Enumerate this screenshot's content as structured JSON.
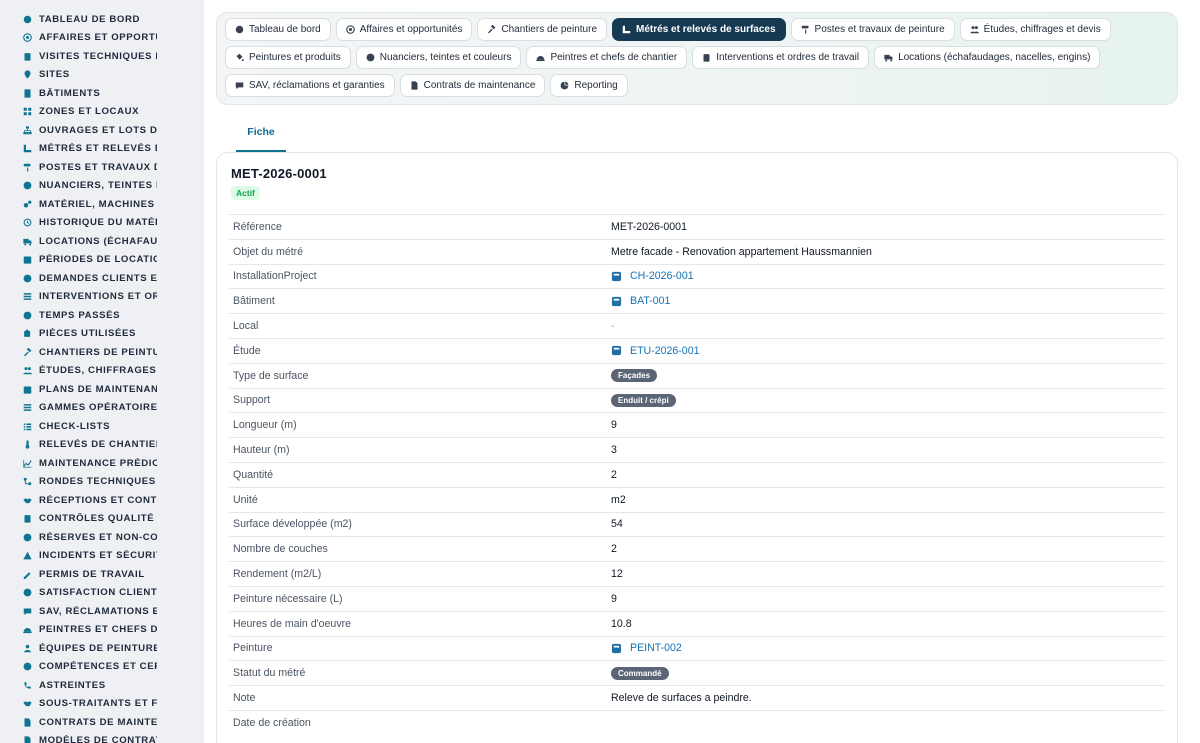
{
  "sidebar": {
    "items": [
      {
        "label": "TABLEAU DE BORD",
        "icon": "dashboard-icon"
      },
      {
        "label": "AFFAIRES ET OPPORTUNITÉS",
        "icon": "target-icon"
      },
      {
        "label": "VISITES TECHNIQUES ET",
        "icon": "clipboard-icon"
      },
      {
        "label": "SITES",
        "icon": "pin-icon"
      },
      {
        "label": "BÂTIMENTS",
        "icon": "building-icon"
      },
      {
        "label": "ZONES ET LOCAUX",
        "icon": "grid-icon"
      },
      {
        "label": "OUVRAGES ET LOTS DE TRAVAUX",
        "icon": "sitemap-icon"
      },
      {
        "label": "MÉTRÉS ET RELEVÉS DE SURFACES",
        "icon": "ruler-icon"
      },
      {
        "label": "POSTES ET TRAVAUX DE PEINTURE",
        "icon": "roller-icon"
      },
      {
        "label": "NUANCIERS, TEINTES ET COULEURS",
        "icon": "palette-icon"
      },
      {
        "label": "MATÉRIEL, MACHINES ET OUTILS",
        "icon": "cogs-icon"
      },
      {
        "label": "HISTORIQUE DU MATÉRIEL",
        "icon": "history-icon"
      },
      {
        "label": "LOCATIONS (ÉCHAFAUDAGES)",
        "icon": "truck-icon"
      },
      {
        "label": "PÉRIODES DE LOCATION",
        "icon": "calendar-icon"
      },
      {
        "label": "DEMANDES CLIENTS ET INTERVENTIONS",
        "icon": "question-icon"
      },
      {
        "label": "INTERVENTIONS ET ORDRES",
        "icon": "wrench-list-icon"
      },
      {
        "label": "TEMPS PASSÉS",
        "icon": "clock-icon"
      },
      {
        "label": "PIÈCES UTILISÉES",
        "icon": "puzzle-icon"
      },
      {
        "label": "CHANTIERS DE PEINTURE",
        "icon": "hammer-icon"
      },
      {
        "label": "ÉTUDES, CHIFFRAGES ET DEVIS",
        "icon": "people-icon"
      },
      {
        "label": "PLANS DE MAINTENANCE",
        "icon": "calendar-check-icon"
      },
      {
        "label": "GAMMES OPÉRATOIRES",
        "icon": "list-ordered-icon"
      },
      {
        "label": "CHECK-LISTS",
        "icon": "checklist-icon"
      },
      {
        "label": "RELEVÉS DE CHANTIER",
        "icon": "thermometer-icon"
      },
      {
        "label": "MAINTENANCE PRÉDICTIVE",
        "icon": "chart-line-icon"
      },
      {
        "label": "RONDES TECHNIQUES",
        "icon": "route-icon"
      },
      {
        "label": "RÉCEPTIONS ET CONTRÔLES",
        "icon": "handshake-icon"
      },
      {
        "label": "CONTRÔLES QUALITÉ ET",
        "icon": "clipboard-check-icon"
      },
      {
        "label": "RÉSERVES ET NON-CONFORMITÉS",
        "icon": "alert-circle-icon"
      },
      {
        "label": "INCIDENTS ET SÉCURITÉ",
        "icon": "warning-icon"
      },
      {
        "label": "PERMIS DE TRAVAIL",
        "icon": "signature-icon"
      },
      {
        "label": "SATISFACTION CLIENT",
        "icon": "smile-icon"
      },
      {
        "label": "SAV, RÉCLAMATIONS ET GARANTIES",
        "icon": "chat-icon"
      },
      {
        "label": "PEINTRES ET CHEFS DE CHANTIER",
        "icon": "helmet-icon"
      },
      {
        "label": "ÉQUIPES DE PEINTURE",
        "icon": "team-icon"
      },
      {
        "label": "COMPÉTENCES ET CERTIFICATIONS",
        "icon": "badge-icon"
      },
      {
        "label": "ASTREINTES",
        "icon": "phone-icon"
      },
      {
        "label": "SOUS-TRAITANTS ET FOURNISSEURS",
        "icon": "handshake-icon"
      },
      {
        "label": "CONTRATS DE MAINTENANCE",
        "icon": "file-contract-icon"
      },
      {
        "label": "MODÈLES DE CONTRATS",
        "icon": "file-icon"
      }
    ]
  },
  "tabs": [
    [
      {
        "label": "Tableau de bord",
        "icon": "dashboard-icon",
        "active": false
      },
      {
        "label": "Affaires et opportunités",
        "icon": "target-icon",
        "active": false
      },
      {
        "label": "Chantiers de peinture",
        "icon": "hammer-icon",
        "active": false
      },
      {
        "label": "Métrés et relevés de surfaces",
        "icon": "ruler-icon",
        "active": true
      },
      {
        "label": "Postes et travaux de peinture",
        "icon": "roller-icon",
        "active": false
      },
      {
        "label": "Études, chiffrages et devis",
        "icon": "people-icon",
        "active": false
      }
    ],
    [
      {
        "label": "Peintures et produits",
        "icon": "paint-bucket-icon",
        "active": false
      },
      {
        "label": "Nuanciers, teintes et couleurs",
        "icon": "palette-icon",
        "active": false
      },
      {
        "label": "Peintres et chefs de chantier",
        "icon": "helmet-icon",
        "active": false
      },
      {
        "label": "Interventions et ordres de travail",
        "icon": "clipboard-icon",
        "active": false
      },
      {
        "label": "Locations (échafaudages, nacelles, engins)",
        "icon": "truck-icon",
        "active": false
      }
    ],
    [
      {
        "label": "SAV, réclamations et garanties",
        "icon": "chat-icon",
        "active": false
      },
      {
        "label": "Contrats de maintenance",
        "icon": "file-contract-icon",
        "active": false
      },
      {
        "label": "Reporting",
        "icon": "pie-chart-icon",
        "active": false
      }
    ]
  ],
  "subtab": {
    "label": "Fiche"
  },
  "record": {
    "title": "MET-2026-0001",
    "status": "Actif",
    "fields": [
      {
        "label": "Référence",
        "type": "text",
        "value": "MET-2026-0001"
      },
      {
        "label": "Objet du métré",
        "type": "text",
        "value": "Metre facade - Renovation appartement Haussmannien"
      },
      {
        "label": "InstallationProject",
        "type": "link",
        "value": "CH-2026-001"
      },
      {
        "label": "Bâtiment",
        "type": "link",
        "value": "BAT-001"
      },
      {
        "label": "Local",
        "type": "dash",
        "value": "-"
      },
      {
        "label": "Étude",
        "type": "link",
        "value": "ETU-2026-001"
      },
      {
        "label": "Type de surface",
        "type": "badge",
        "value": "Façades"
      },
      {
        "label": "Support",
        "type": "badge",
        "value": "Enduit / crépi"
      },
      {
        "label": "Longueur (m)",
        "type": "text",
        "value": "9"
      },
      {
        "label": "Hauteur (m)",
        "type": "text",
        "value": "3"
      },
      {
        "label": "Quantité",
        "type": "text",
        "value": "2"
      },
      {
        "label": "Unité",
        "type": "text",
        "value": "m2"
      },
      {
        "label": "Surface développée (m2)",
        "type": "text",
        "value": "54"
      },
      {
        "label": "Nombre de couches",
        "type": "text",
        "value": "2"
      },
      {
        "label": "Rendement (m2/L)",
        "type": "text",
        "value": "12"
      },
      {
        "label": "Peinture nécessaire (L)",
        "type": "text",
        "value": "9"
      },
      {
        "label": "Heures de main d'oeuvre",
        "type": "text",
        "value": "10.8"
      },
      {
        "label": "Peinture",
        "type": "link",
        "value": "PEINT-002"
      },
      {
        "label": "Statut du métré",
        "type": "badge",
        "value": "Commandé"
      },
      {
        "label": "Note",
        "type": "text",
        "value": "Releve de surfaces a peindre."
      },
      {
        "label": "Date de création",
        "type": "text",
        "value": ""
      }
    ]
  },
  "colors": {
    "active_tab_bg": "#163a52",
    "link": "#1572b6",
    "status_green": "#16a34a",
    "badge_gray": "#5b6575",
    "sidebar_icon": "#0e7490"
  }
}
